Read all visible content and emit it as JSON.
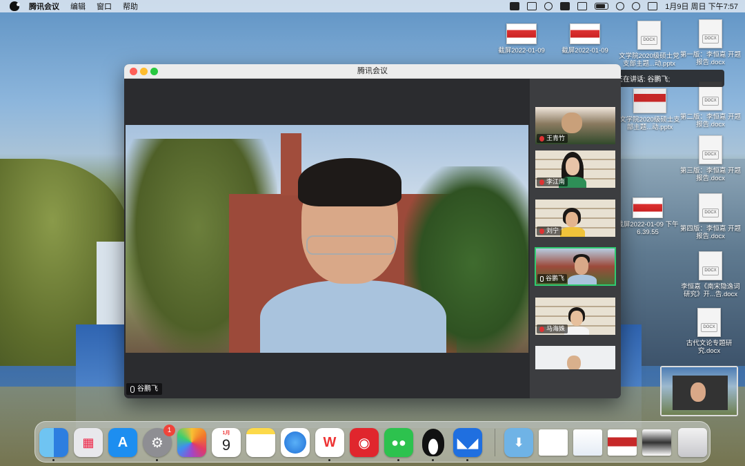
{
  "menubar": {
    "app_name": "腾讯会议",
    "menus": [
      "编辑",
      "窗口",
      "帮助"
    ],
    "clock": "1月9日 周日 下午7:57"
  },
  "desktop_files": [
    {
      "label": "截屏2022-01-09",
      "kind": "screenshot"
    },
    {
      "label": "截屏2022-01-09",
      "kind": "screenshot"
    },
    {
      "label": "文学院2020级硕士党支部主题...动.pptx",
      "kind": "doc"
    },
    {
      "label": "第一版：李恒嘉 开题报告.docx",
      "kind": "doc"
    },
    {
      "label": "文学院2020级硕士支部主题...动.pptx",
      "kind": "ppt"
    },
    {
      "label": "第二版：李恒嘉 开题报告.docx",
      "kind": "doc"
    },
    {
      "label": "第三版：李恒嘉 开题报告.docx",
      "kind": "doc"
    },
    {
      "label": "截屏2022-01-09 下午6.39.55",
      "kind": "screenshot"
    },
    {
      "label": "第四版：李恒嘉 开题报告.docx",
      "kind": "doc"
    },
    {
      "label": "李恒嘉《南宋隐逸词研究》开...告.docx",
      "kind": "doc"
    },
    {
      "label": "古代文论专题研究.docx",
      "kind": "doc"
    }
  ],
  "meeting": {
    "window_title": "腾讯会议",
    "main_speaker": "谷鹏飞",
    "speaking_banner": "正在讲话: 谷鹏飞;",
    "participants": [
      {
        "name": "王青竹",
        "muted": true
      },
      {
        "name": "李江南",
        "muted": true
      },
      {
        "name": "刘宁",
        "muted": true
      },
      {
        "name": "谷鹏飞",
        "muted": false,
        "active": true
      },
      {
        "name": "马海姝",
        "muted": true
      },
      {
        "name": "",
        "muted": true
      }
    ]
  },
  "dock": {
    "apps": [
      "Finder",
      "Launchpad",
      "App Store",
      "System Preferences",
      "Photos",
      "Calendar",
      "Notes",
      "Safari",
      "WPS",
      "NetEase Music",
      "WeChat",
      "QQ",
      "Tencent Meeting"
    ],
    "calendar_month": "1月",
    "calendar_day": "9",
    "settings_badge": "1"
  },
  "colors": {
    "active_tile_border": "#2ecc71",
    "muted_mic": "#dd3333"
  }
}
